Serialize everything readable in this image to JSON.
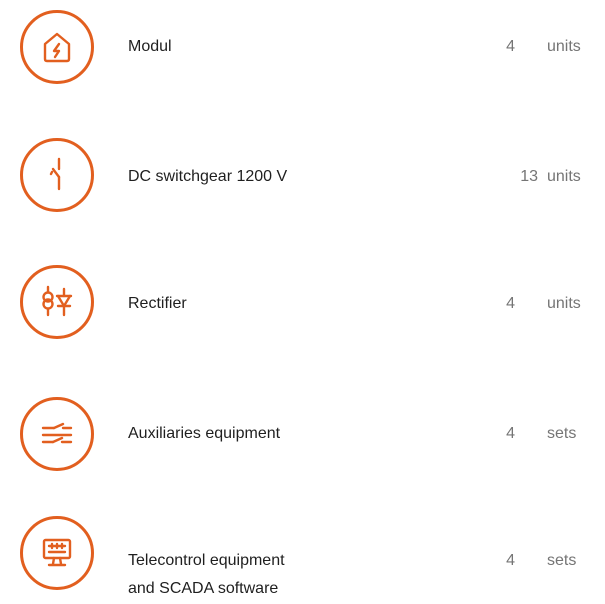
{
  "accent_color": "#e25f1f",
  "items": [
    {
      "name": "Modul",
      "quantity": "4",
      "unit": "units",
      "icon": "house-lightning-icon"
    },
    {
      "name": "DC switchgear 1200 V",
      "quantity": "13",
      "unit": "units",
      "icon": "switch-icon"
    },
    {
      "name": "Rectifier",
      "quantity": "4",
      "unit": "units",
      "icon": "transformer-diode-icon"
    },
    {
      "name": "Auxiliaries equipment",
      "quantity": "4",
      "unit": "sets",
      "icon": "breaker-lines-icon"
    },
    {
      "name": "Telecontrol equipment",
      "name_line2": "and SCADA software",
      "quantity": "4",
      "unit": "sets",
      "icon": "monitor-icon"
    }
  ]
}
